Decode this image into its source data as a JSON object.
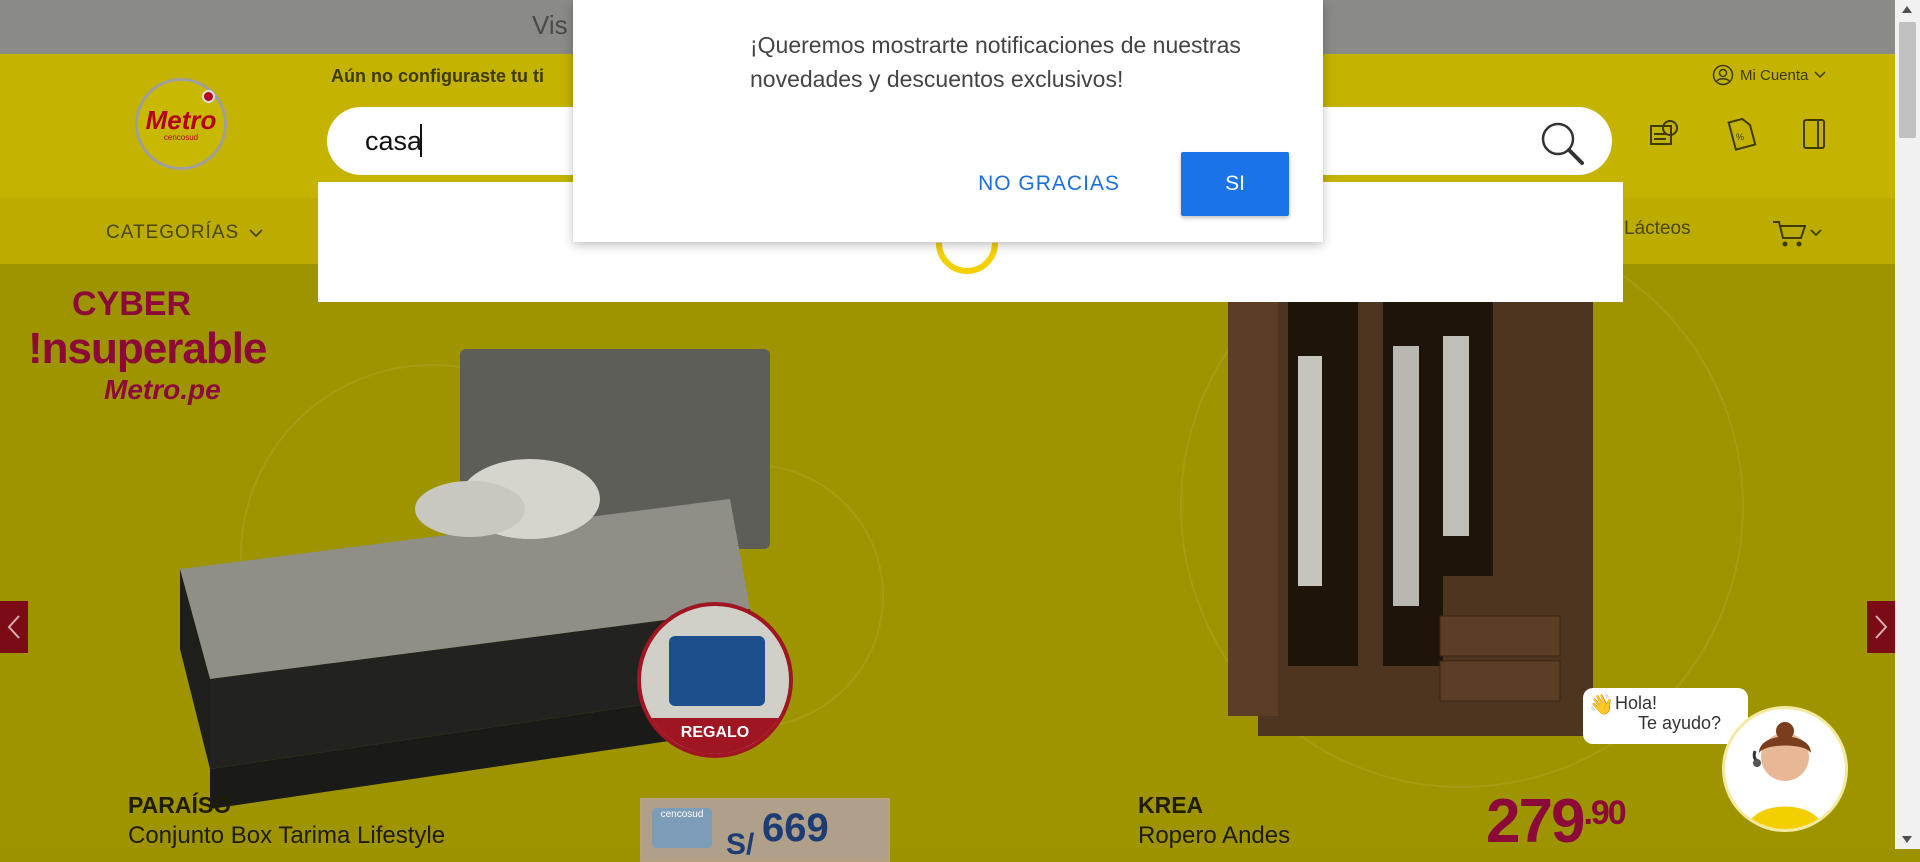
{
  "top_bar": {
    "text": "Vis"
  },
  "header": {
    "logo": {
      "brand": "Metro",
      "sub": "cencosud"
    },
    "config_text": "Aún no configuraste tu ti",
    "search": {
      "value": "casa"
    },
    "account_label": "Mi Cuenta"
  },
  "nav": {
    "categories_label": "CATEGORÍAS",
    "visible_item": "Lácteos"
  },
  "dialog": {
    "message": "¡Queremos mostrarte notificaciones de nuestras novedades y descuentos exclusivos!",
    "no_label": "NO GRACIAS",
    "yes_label": "SI"
  },
  "banner": {
    "campaign": {
      "line1": "CYBER",
      "line2": "!nsuperable",
      "line3": "Metro.pe"
    },
    "product1": {
      "brand": "PARAÍSO",
      "name": "Conjunto Box Tarima Lifestyle",
      "gift": "REGALO",
      "currency": "S/",
      "price": "669",
      "card": "cencosud"
    },
    "product2": {
      "brand": "KREA",
      "name": "Ropero Andes",
      "price_int": "279",
      "price_dec": ".90"
    }
  },
  "chat": {
    "line1": "Hola!",
    "line2": "Te ayudo?",
    "wave": "👋"
  },
  "colors": {
    "brand_red": "#b3001e",
    "header_yellow": "#c4b300",
    "dialog_blue": "#1a73e8"
  }
}
